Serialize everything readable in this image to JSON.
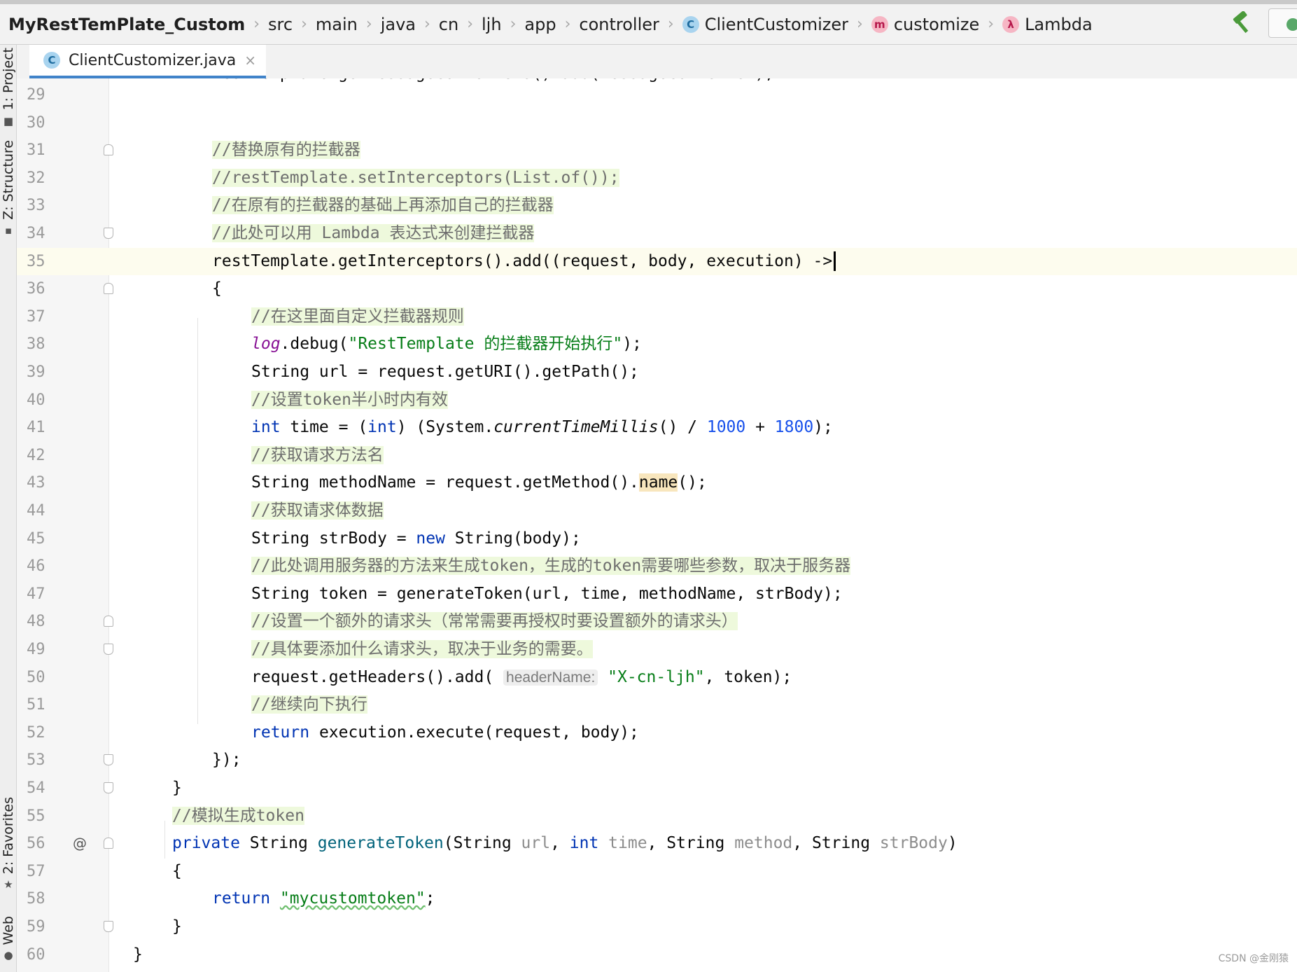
{
  "breadcrumb": {
    "project": "MyRestTemPlate_Custom",
    "items": [
      "src",
      "main",
      "java",
      "cn",
      "ljh",
      "app",
      "controller"
    ],
    "class_name": "ClientCustomizer",
    "method_name": "customize",
    "lambda_name": "Lambda",
    "class_icon": "C",
    "method_icon": "m",
    "lambda_icon": "λ"
  },
  "toolwindows": {
    "project": "1: Project",
    "structure": "Z: Structure",
    "favorites": "2: Favorites",
    "web": "Web"
  },
  "tab": {
    "filename": "ClientCustomizer.java",
    "icon": "C",
    "close": "×"
  },
  "partial_line": "restTemplate.getMessageConverters().add(messageConverter);",
  "lines": [
    {
      "n": "29",
      "code": ""
    },
    {
      "n": "30",
      "code": ""
    },
    {
      "n": "31",
      "code": "//替换原有的拦截器"
    },
    {
      "n": "32",
      "code": "//restTemplate.setInterceptors(List.of());"
    },
    {
      "n": "33",
      "code": "//在原有的拦截器的基础上再添加自己的拦截器"
    },
    {
      "n": "34",
      "code": "//此处可以用 Lambda 表达式来创建拦截器"
    },
    {
      "n": "35",
      "code": "restTemplate.getInterceptors().add((request, body, execution) ->"
    },
    {
      "n": "36",
      "code": "{"
    },
    {
      "n": "37",
      "code": "//在这里面自定义拦截器规则"
    },
    {
      "n": "38",
      "code": "log.debug(\"RestTemplate 的拦截器开始执行\");"
    },
    {
      "n": "39",
      "code": "String url = request.getURI().getPath();"
    },
    {
      "n": "40",
      "code": "//设置token半小时内有效"
    },
    {
      "n": "41",
      "code": "int time = (int) (System.currentTimeMillis() / 1000 + 1800);"
    },
    {
      "n": "42",
      "code": "//获取请求方法名"
    },
    {
      "n": "43",
      "code": "String methodName = request.getMethod().name();"
    },
    {
      "n": "44",
      "code": "//获取请求体数据"
    },
    {
      "n": "45",
      "code": "String strBody = new String(body);"
    },
    {
      "n": "46",
      "code": "//此处调用服务器的方法来生成token，生成的token需要哪些参数，取决于服务器"
    },
    {
      "n": "47",
      "code": "String token = generateToken(url, time, methodName, strBody);"
    },
    {
      "n": "48",
      "code": "//设置一个额外的请求头（常常需要再授权时要设置额外的请求头）"
    },
    {
      "n": "49",
      "code": "//具体要添加什么请求头，取决于业务的需要。"
    },
    {
      "n": "50",
      "code": "request.getHeaders().add( headerName: \"X-cn-ljh\", token);"
    },
    {
      "n": "51",
      "code": "//继续向下执行"
    },
    {
      "n": "52",
      "code": "return execution.execute(request, body);"
    },
    {
      "n": "53",
      "code": "});"
    },
    {
      "n": "54",
      "code": "}"
    },
    {
      "n": "55",
      "code": "//模拟生成token"
    },
    {
      "n": "56",
      "code": "private String generateToken(String url, int time, String method, String strBody)"
    },
    {
      "n": "57",
      "code": "{"
    },
    {
      "n": "58",
      "code": "return \"mycustomtoken\";"
    },
    {
      "n": "59",
      "code": "}"
    },
    {
      "n": "60",
      "code": "}"
    }
  ],
  "watermark": "CSDN @金刚猿",
  "colors": {
    "keyword": "#0033b3",
    "string": "#067d17",
    "number": "#1750eb",
    "comment_bg": "#eef9dc",
    "current_line": "#fdfcee"
  }
}
